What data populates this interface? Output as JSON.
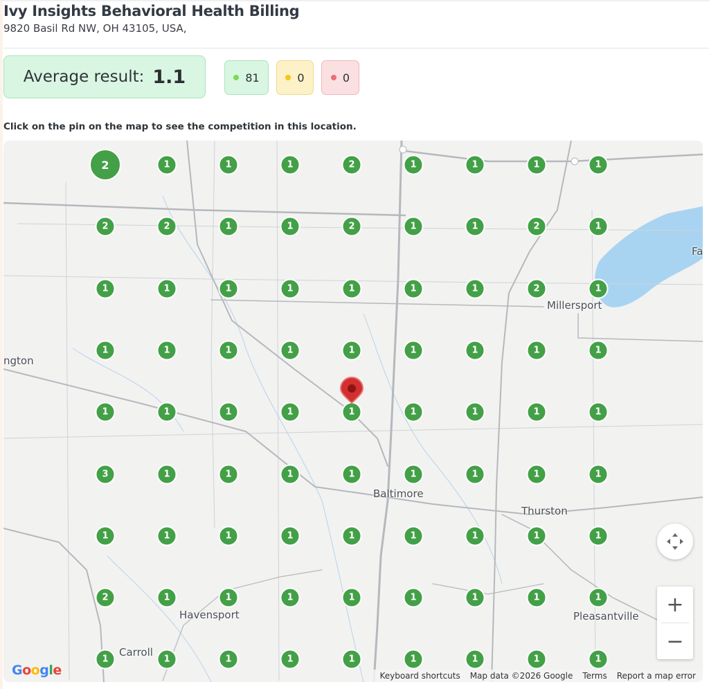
{
  "business": {
    "name": "Ivy Insights Behavioral Health Billing",
    "address": "9820 Basil Rd NW, OH 43105, USA,"
  },
  "summary": {
    "average_label": "Average result:",
    "average_value": "1.1",
    "counts": {
      "good": "81",
      "medium": "0",
      "bad": "0"
    }
  },
  "colors": {
    "good": "#7ed957",
    "medium": "#f5c518",
    "bad": "#e8707a",
    "pin": "#43a047",
    "center_marker": "#d32f2f"
  },
  "hint": "Click on the pin on the map to see the competition in this location.",
  "map": {
    "grid_ranks": [
      [
        "2",
        "1",
        "1",
        "1",
        "2",
        "1",
        "1",
        "1",
        "1"
      ],
      [
        "2",
        "2",
        "1",
        "1",
        "2",
        "1",
        "1",
        "2",
        "1"
      ],
      [
        "1",
        "1",
        "1",
        "1",
        "1",
        "1",
        "1",
        "2",
        "1"
      ],
      [
        "1",
        "1",
        "1",
        "1",
        "1",
        "1",
        "1",
        "1",
        "1"
      ],
      [
        "1",
        "1",
        "1",
        "1",
        "1",
        "1",
        "1",
        "1",
        "1"
      ],
      [
        "3",
        "1",
        "1",
        "1",
        "1",
        "1",
        "1",
        "1",
        "1"
      ],
      [
        "1",
        "1",
        "1",
        "1",
        "1",
        "1",
        "1",
        "1",
        "1"
      ],
      [
        "2",
        "1",
        "1",
        "1",
        "1",
        "1",
        "1",
        "1",
        "1"
      ],
      [
        "1",
        "1",
        "1",
        "1",
        "1",
        "1",
        "1",
        "1",
        "1"
      ]
    ],
    "places": {
      "millersport": "Millersport",
      "baltimore": "Baltimore",
      "thurston": "Thurston",
      "havensport": "Havensport",
      "pleasantville": "Pleasantville",
      "carroll": "Carroll",
      "lancaster_partial": "ngton",
      "fairfield_partial": "Fa"
    },
    "controls": {
      "zoom_in": "+",
      "zoom_out": "−"
    },
    "logo": "Google",
    "attribution": {
      "shortcuts": "Keyboard shortcuts",
      "map_data": "Map data ©2026 Google",
      "terms": "Terms",
      "report": "Report a map error"
    }
  }
}
